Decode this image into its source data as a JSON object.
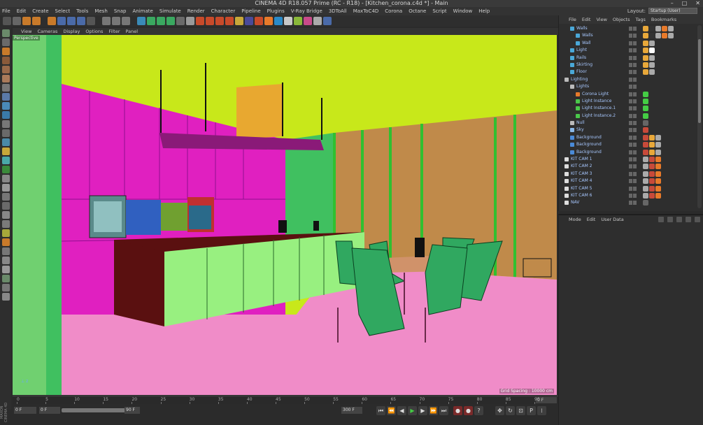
{
  "window": {
    "title": "CINEMA 4D R18.057 Prime (RC - R18) - [Kitchen_corona.c4d *] - Main",
    "controls": [
      "–",
      "□",
      "✕"
    ]
  },
  "menubar": [
    "File",
    "Edit",
    "Create",
    "Select",
    "Tools",
    "Mesh",
    "Snap",
    "Animate",
    "Simulate",
    "Render",
    "Character",
    "Pipeline",
    "Plugins",
    "V-Ray Bridge",
    "3DToAll",
    "MaxToC4D",
    "Corona",
    "Octane",
    "Script",
    "Window",
    "Help"
  ],
  "layout": {
    "label": "Layout:",
    "value": "Startup (User)"
  },
  "viewport": {
    "menu": [
      "View",
      "Cameras",
      "Display",
      "Options",
      "Filter",
      "Panel"
    ],
    "camera_label": "Perspective",
    "grid_spacing": "Grid Spacing : 10000 cm"
  },
  "timeline": {
    "ticks": [
      "0",
      "5",
      "10",
      "15",
      "20",
      "25",
      "30",
      "35",
      "40",
      "45",
      "50",
      "55",
      "60",
      "65",
      "70",
      "75",
      "80",
      "85",
      "90"
    ],
    "current_frame": "0 F"
  },
  "playback": {
    "start_field": "0 F",
    "min_field": "0 F",
    "max_field": "90 F",
    "end_field": "300 F",
    "preview_min": "0 F"
  },
  "object_manager": {
    "menu": [
      "File",
      "Edit",
      "View",
      "Objects",
      "Tags",
      "Bookmarks"
    ],
    "rows": [
      {
        "label": "Walls"
      },
      {
        "label": "Walls"
      },
      {
        "label": "Wall"
      },
      {
        "label": "Light"
      },
      {
        "label": "Rails"
      },
      {
        "label": "Skirting"
      },
      {
        "label": "Floor"
      },
      {
        "label": "Lighting"
      },
      {
        "label": "Lights"
      },
      {
        "label": "Corona Light"
      },
      {
        "label": "Light Instance"
      },
      {
        "label": "Light Instance.1"
      },
      {
        "label": "Light Instance.2"
      },
      {
        "label": "Null"
      },
      {
        "label": "Sky"
      },
      {
        "label": "Background"
      },
      {
        "label": "Background"
      },
      {
        "label": "Background"
      },
      {
        "label": "KIT CAM 1"
      },
      {
        "label": "KIT CAM 2"
      },
      {
        "label": "KIT CAM 3"
      },
      {
        "label": "KIT CAM 4"
      },
      {
        "label": "KIT CAM 5"
      },
      {
        "label": "KIT CAM 6"
      },
      {
        "label": "NAV"
      }
    ]
  },
  "attribute_manager": {
    "menu": [
      "Mode",
      "Edit",
      "User Data"
    ]
  },
  "logo": "MAXON CINEMA 4D",
  "colors": {
    "ceiling": "#c8e81a",
    "left_wall": "#e020c0",
    "floor": "#f08cc8",
    "window_wall": "#c08a4a",
    "cabinets": "#98f080",
    "chairs": "#30a860",
    "island_side": "#5a1010",
    "hood": "#e8a830",
    "lamp_rack": "#8a1a78"
  }
}
